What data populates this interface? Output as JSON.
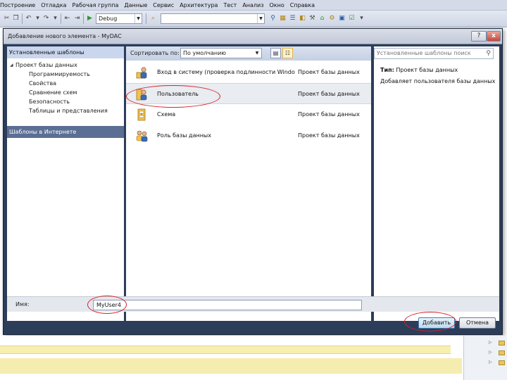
{
  "menu": {
    "items": [
      "Построение",
      "Отладка",
      "Рабочая группа",
      "Данные",
      "Сервис",
      "Архитектура",
      "Тест",
      "Анализ",
      "Окно",
      "Справка"
    ]
  },
  "toolbar": {
    "config_combo": "Debug",
    "find_combo": ""
  },
  "dialog": {
    "title": "Добавление нового элемента - MyDAC",
    "help_button": "?",
    "close_button": "x",
    "left": {
      "installed_header": "Установленные шаблоны",
      "tree": [
        {
          "label": "Проект базы данных",
          "level": 0,
          "expanded": true
        },
        {
          "label": "Программируемость",
          "level": 1
        },
        {
          "label": "Свойства",
          "level": 1
        },
        {
          "label": "Сравнение схем",
          "level": 1
        },
        {
          "label": "Безопасность",
          "level": 1
        },
        {
          "label": "Таблицы и представления",
          "level": 1
        }
      ],
      "online_header": "Шаблоны в Интернете"
    },
    "middle": {
      "sort_label": "Сортировать по:",
      "sort_value": "По умолчанию",
      "items": [
        {
          "name": "Вход в систему (проверка подлинности Windo...",
          "category": "Проект базы данных",
          "icon": "login-icon",
          "selected": false
        },
        {
          "name": "Пользователь",
          "category": "Проект базы данных",
          "icon": "user-icon",
          "selected": true
        },
        {
          "name": "Схема",
          "category": "Проект базы данных",
          "icon": "schema-icon",
          "selected": false
        },
        {
          "name": "Роль базы данных",
          "category": "Проект базы данных",
          "icon": "role-icon",
          "selected": false
        }
      ]
    },
    "right": {
      "search_placeholder": "Установленные шаблоны поиск",
      "type_label": "Тип:",
      "type_value": "Проект базы данных",
      "description": "Добавляет пользователя базы данных"
    },
    "name_label": "Имя:",
    "name_value": "MyUser4",
    "add_button": "Добавить",
    "cancel_button": "Отмена"
  },
  "colors": {
    "annotation": "#d8222a",
    "dialog_frame": "#2c3d5a",
    "selected_header": "#c9d6ee",
    "online_header": "#5b6e93"
  }
}
